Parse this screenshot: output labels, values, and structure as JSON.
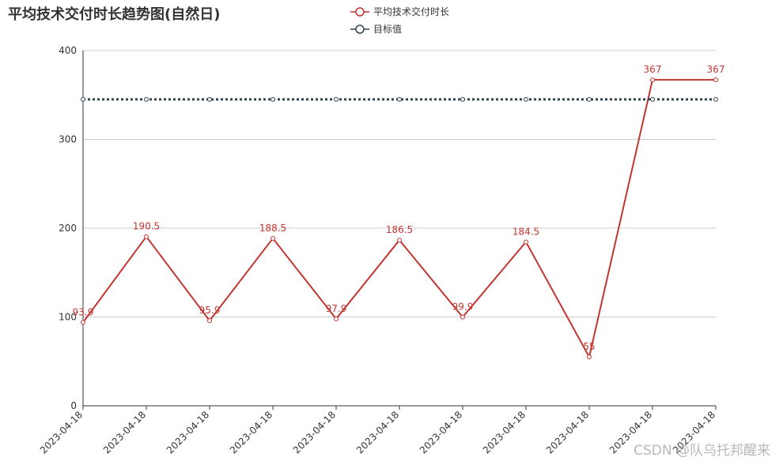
{
  "watermark": "CSDN @队乌托邦醒来",
  "chart_data": {
    "type": "line",
    "title": "平均技术交付时长趋势图(自然日)",
    "x": [
      "2023-04-18",
      "2023-04-18",
      "2023-04-18",
      "2023-04-18",
      "2023-04-18",
      "2023-04-18",
      "2023-04-18",
      "2023-04-18",
      "2023-04-18",
      "2023-04-18",
      "2023-04-18"
    ],
    "ylim": [
      0,
      400
    ],
    "yticks": [
      0,
      100,
      200,
      300,
      400
    ],
    "grid": true,
    "legend_position": "top-center",
    "series": [
      {
        "name": "平均技术交付时长",
        "color": "#c23531",
        "values": [
          93.9,
          190.5,
          95.9,
          188.5,
          97.9,
          186.5,
          99.9,
          184.5,
          55,
          367,
          367
        ],
        "labels": [
          "93.9",
          "190.5",
          "95.9",
          "188.5",
          "97.9",
          "186.5",
          "99.9",
          "184.5",
          "55",
          "367",
          "367"
        ],
        "line_style": "solid"
      },
      {
        "name": "目标值",
        "color": "#2f4554",
        "values": [
          345,
          345,
          345,
          345,
          345,
          345,
          345,
          345,
          345,
          345,
          345
        ],
        "line_style": "dotted"
      }
    ]
  }
}
